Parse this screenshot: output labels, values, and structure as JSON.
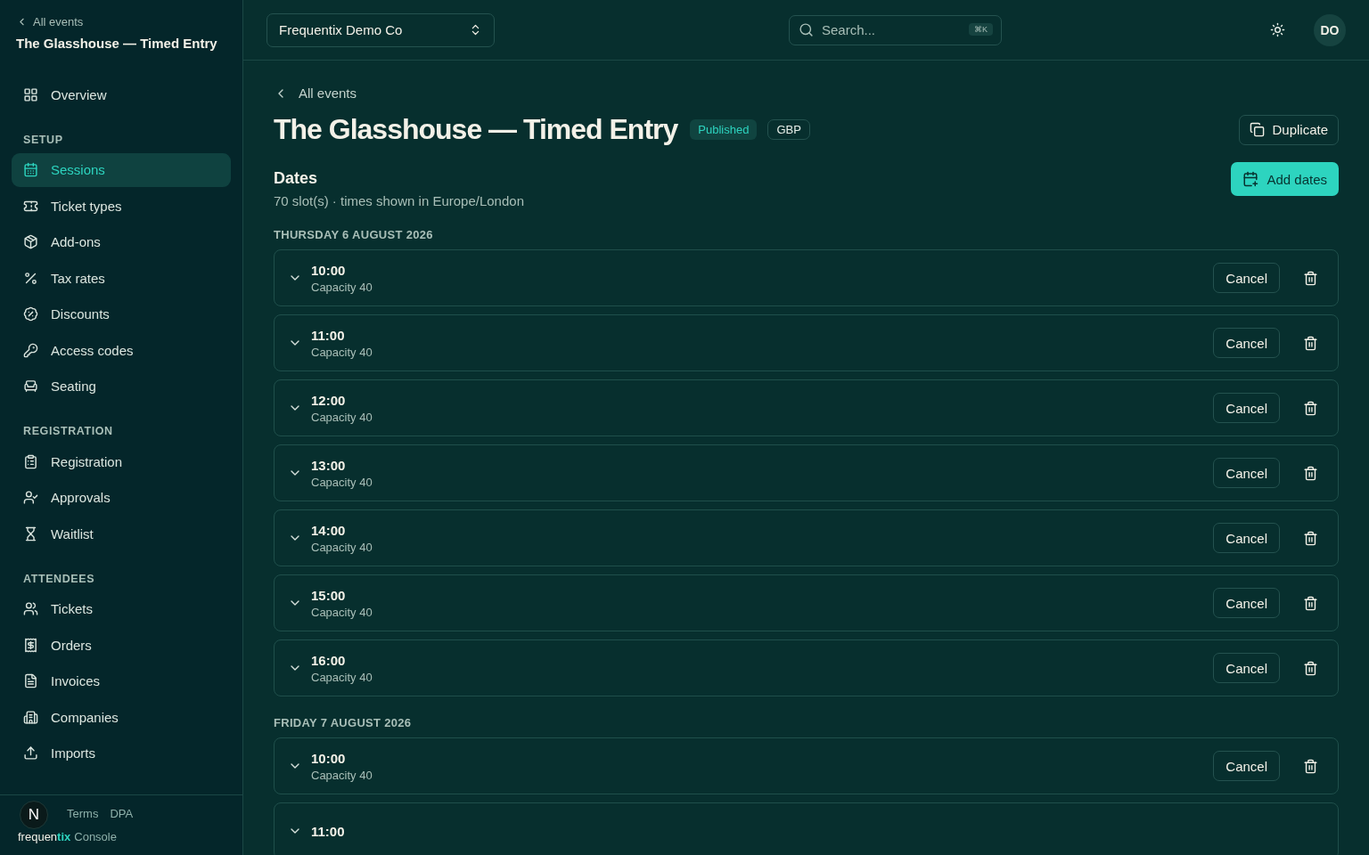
{
  "sidebar": {
    "back_link": "All events",
    "event_title": "The Glasshouse — Timed Entry",
    "sections": [
      {
        "items": [
          {
            "label": "Overview",
            "selected": false
          }
        ]
      },
      {
        "heading": "SETUP",
        "items": [
          {
            "label": "Sessions",
            "selected": true
          },
          {
            "label": "Ticket types",
            "selected": false
          },
          {
            "label": "Add-ons",
            "selected": false
          },
          {
            "label": "Tax rates",
            "selected": false
          },
          {
            "label": "Discounts",
            "selected": false
          },
          {
            "label": "Access codes",
            "selected": false
          },
          {
            "label": "Seating",
            "selected": false
          }
        ]
      },
      {
        "heading": "REGISTRATION",
        "items": [
          {
            "label": "Registration",
            "selected": false
          },
          {
            "label": "Approvals",
            "selected": false
          },
          {
            "label": "Waitlist",
            "selected": false
          }
        ]
      },
      {
        "heading": "ATTENDEES",
        "items": [
          {
            "label": "Tickets",
            "selected": false
          },
          {
            "label": "Orders",
            "selected": false
          },
          {
            "label": "Invoices",
            "selected": false
          },
          {
            "label": "Companies",
            "selected": false
          },
          {
            "label": "Imports",
            "selected": false
          }
        ]
      }
    ],
    "footer_links": [
      "Terms",
      "DPA"
    ],
    "brand": "frequen**tix**",
    "brand_suffix": "Console",
    "dev_badge": "N"
  },
  "header": {
    "org": "Frequentix Demo Co",
    "search": {
      "placeholder": "Search...",
      "shortcut": "⌘K"
    },
    "avatar": "DO"
  },
  "page": {
    "back_link": "All events",
    "title": "The Glasshouse — Timed Entry",
    "status": "Published",
    "currency": "GBP",
    "duplicate": "Duplicate",
    "add_dates": "Add dates",
    "section_title": "Dates",
    "section_subtitle": "70 slot(s) · times shown in Europe/London",
    "days": [
      {
        "heading": "THURSDAY 6 AUGUST 2026",
        "slots": [
          {
            "time": "10:00",
            "capacity": "Capacity 40",
            "cancel": "Cancel"
          },
          {
            "time": "11:00",
            "capacity": "Capacity 40",
            "cancel": "Cancel"
          },
          {
            "time": "12:00",
            "capacity": "Capacity 40",
            "cancel": "Cancel"
          },
          {
            "time": "13:00",
            "capacity": "Capacity 40",
            "cancel": "Cancel"
          },
          {
            "time": "14:00",
            "capacity": "Capacity 40",
            "cancel": "Cancel"
          },
          {
            "time": "15:00",
            "capacity": "Capacity 40",
            "cancel": "Cancel"
          },
          {
            "time": "16:00",
            "capacity": "Capacity 40",
            "cancel": "Cancel"
          }
        ]
      },
      {
        "heading": "FRIDAY 7 AUGUST 2026",
        "slots": [
          {
            "time": "10:00",
            "capacity": "Capacity 40",
            "cancel": "Cancel"
          },
          {
            "time": "11:00"
          }
        ]
      }
    ]
  }
}
